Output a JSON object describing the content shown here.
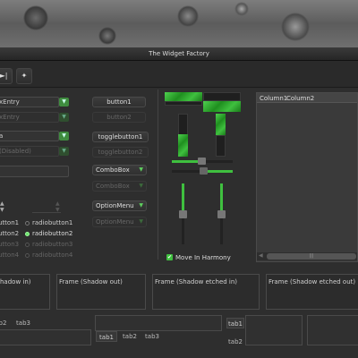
{
  "window": {
    "title": "The Widget Factory"
  },
  "toolbar": {
    "btn_a": "►|",
    "btn_b": "✦"
  },
  "entries": [
    {
      "text": "xEntry",
      "disabled": false
    },
    {
      "text": "xEntry",
      "disabled": true
    },
    {
      "text": "a",
      "disabled": false
    },
    {
      "text": "(Disabled)",
      "disabled": true
    }
  ],
  "buttons": {
    "button1": "button1",
    "button2": "button2",
    "toggle1": "togglebutton1",
    "toggle2": "togglebutton2"
  },
  "combos": {
    "combobox": "ComboBox",
    "combobox_dis": "ComboBox",
    "optionmenu": "OptionMenu",
    "optionmenu_dis": "OptionMenu"
  },
  "radios_left": [
    "utton1",
    "utton2",
    "utton3",
    "utton4"
  ],
  "radios_right": [
    {
      "label": "radiobutton1",
      "checked": false
    },
    {
      "label": "radiobutton2",
      "checked": true
    },
    {
      "label": "radiobutton3",
      "checked": false,
      "disabled": true
    },
    {
      "label": "radiobutton4",
      "checked": false,
      "disabled": true
    }
  ],
  "harmony": {
    "label": "Move In Harmony",
    "checked": true
  },
  "list": {
    "columns": [
      "Column1",
      "Column2"
    ]
  },
  "frames": [
    "hadow in)",
    "Frame (Shadow out)",
    "Frame (Shadow etched in)",
    "Frame (Shadow etched out)"
  ],
  "tabs": {
    "set1": [
      "b2",
      "tab3"
    ],
    "set2": [
      "tab1",
      "tab2",
      "tab3"
    ],
    "set3": [
      "tab1",
      "tab2"
    ]
  },
  "scrollbar_center": "|||",
  "colors": {
    "accent": "#3fc03f",
    "window_bg": "#2e2e2e"
  }
}
